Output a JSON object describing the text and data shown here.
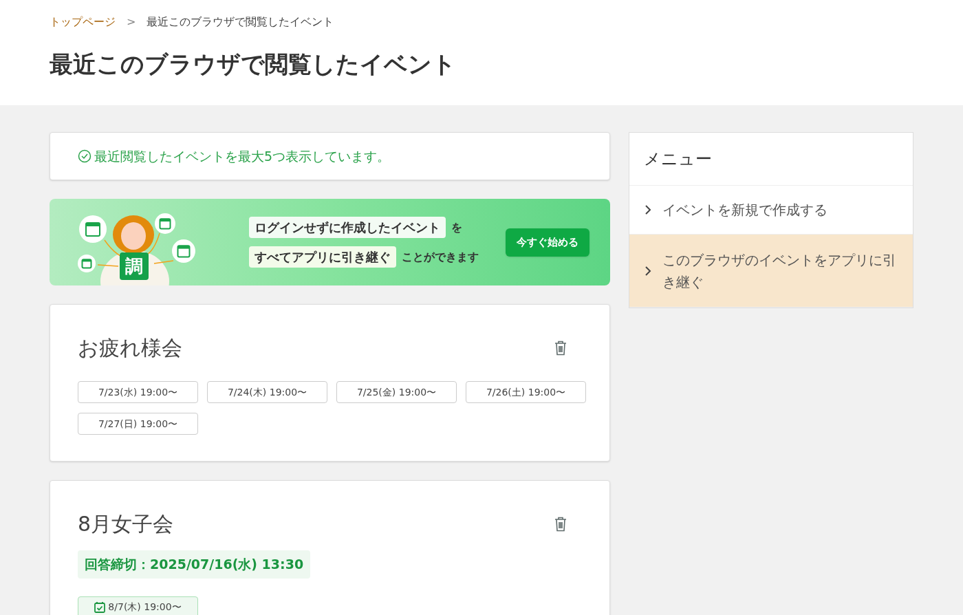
{
  "breadcrumb": [
    {
      "label": "トップページ",
      "link": true
    },
    {
      "label": "最近このブラウザで閲覧したイベント",
      "link": false
    }
  ],
  "breadcrumb_separator": ">",
  "page_title": "最近このブラウザで閲覧したイベント",
  "notice": "最近閲覧したイベントを最大5つ表示しています。",
  "banner": {
    "logo_char": "調",
    "line1_highlight": "ログインせずに作成したイベント",
    "line1_rest": "を",
    "line2_highlight": "すべてアプリに引き継ぐ",
    "line2_rest": "ことができます",
    "button": "今すぐ始める"
  },
  "events": [
    {
      "title": "お疲れ様会",
      "dates": [
        {
          "label": "7/23(水) 19:00〜",
          "confirmed": false
        },
        {
          "label": "7/24(木) 19:00〜",
          "confirmed": false
        },
        {
          "label": "7/25(金) 19:00〜",
          "confirmed": false
        },
        {
          "label": "7/26(土) 19:00〜",
          "confirmed": false
        },
        {
          "label": "7/27(日) 19:00〜",
          "confirmed": false
        }
      ]
    },
    {
      "title": "8月女子会",
      "deadline": "回答締切：2025/07/16(水) 13:30",
      "dates": [
        {
          "label": "8/7(木) 19:00〜",
          "confirmed": true
        }
      ]
    }
  ],
  "menu": {
    "title": "メニュー",
    "items": [
      {
        "label": "イベントを新規で作成する",
        "selected": false
      },
      {
        "label": "このブラウザのイベントをアプリに引き継ぐ",
        "selected": true
      }
    ]
  }
}
